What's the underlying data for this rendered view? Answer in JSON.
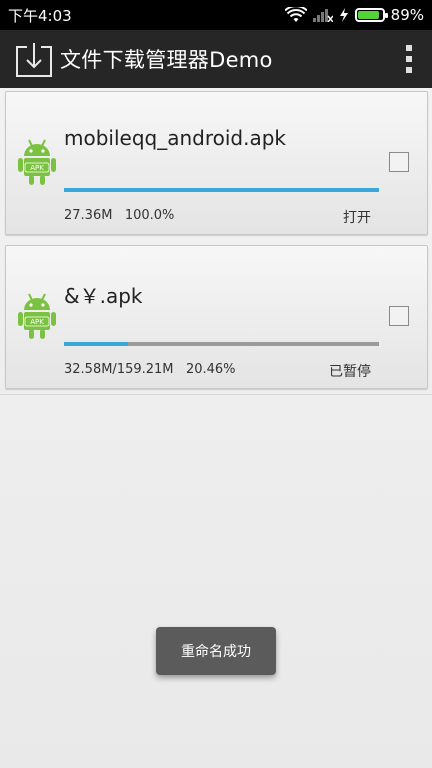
{
  "status_bar": {
    "time": "下午4:03",
    "battery_level": "89%",
    "battery_fraction": 0.89,
    "battery_color": "#55d43a"
  },
  "action_bar": {
    "title": "文件下载管理器Demo",
    "app_icon": "download-icon",
    "overflow_icon": "overflow-menu-icon"
  },
  "downloads": [
    {
      "file_name": "mobileqq_android.apk",
      "size": "27.36M",
      "percent": "100.0%",
      "progress_fraction": 1.0,
      "action": "打开",
      "checked": false,
      "icon": "android-apk-icon"
    },
    {
      "file_name": "&￥.apk",
      "size": "32.58M/159.21M",
      "percent": "20.46%",
      "progress_fraction": 0.2046,
      "action": "已暂停",
      "checked": false,
      "icon": "android-apk-icon"
    }
  ],
  "toast": {
    "message": "重命名成功"
  },
  "colors": {
    "progress": "#3aa7da",
    "action_bar": "#262626"
  }
}
